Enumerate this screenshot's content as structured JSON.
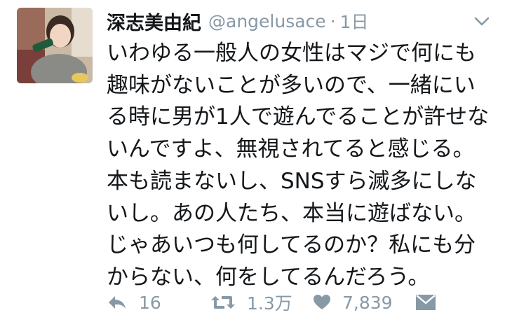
{
  "tweet": {
    "display_name": "深志美由紀",
    "handle": "@angelusace",
    "separator": "·",
    "time": "1日",
    "text": "いわゆる一般人の女性はマジで何にも趣味がないことが多いので、一緒にいる時に男が1人で遊んでることが許せないんですよ、無視されてると感じる。本も読まないし、SNSすら滅多にしないし。あの人たち、本当に遊ばない。じゃあいつも何してるのか？私にも分からない、何をしてるんだろう。"
  },
  "actions": {
    "reply_count": "16",
    "retweet_count": "1.3万",
    "like_count": "7,839"
  },
  "icons": {
    "reply": "reply-icon",
    "retweet": "retweet-icon",
    "like": "heart-icon",
    "dm": "envelope-icon",
    "menu": "chevron-down-icon"
  },
  "colors": {
    "text": "#14171a",
    "muted": "#8899a6"
  }
}
